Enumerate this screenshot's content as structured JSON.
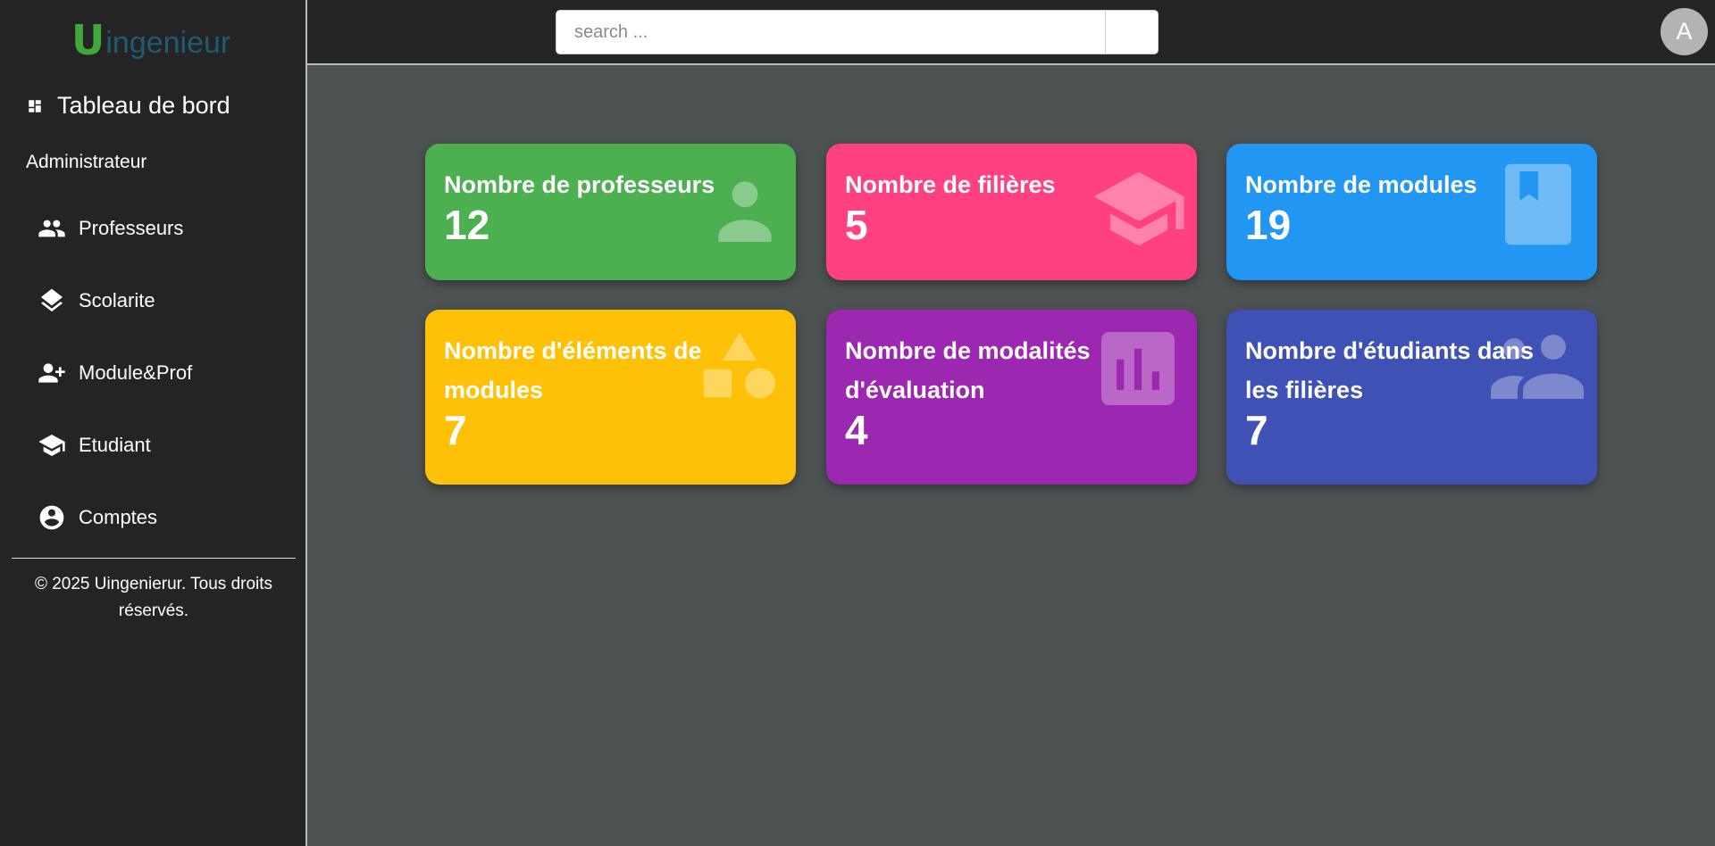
{
  "brand": {
    "logo_letter": "U",
    "logo_rest": "ingenieur"
  },
  "sidebar": {
    "dashboard_label": "Tableau de bord",
    "section_label": "Administrateur",
    "items": [
      {
        "label": "Professeurs",
        "icon": "people-icon"
      },
      {
        "label": "Scolarite",
        "icon": "layers-icon"
      },
      {
        "label": "Module&Prof",
        "icon": "person-add-icon"
      },
      {
        "label": "Etudiant",
        "icon": "school-icon"
      },
      {
        "label": "Comptes",
        "icon": "account-circle-icon"
      }
    ],
    "footer": "© 2025 Uingenierur. Tous droits réservés."
  },
  "topbar": {
    "search_placeholder": "search ...",
    "search_value": "",
    "avatar_letter": "A"
  },
  "cards": [
    {
      "title": "Nombre de professeurs",
      "value": "12",
      "color": "#4caf50",
      "icon": "person-icon"
    },
    {
      "title": "Nombre de filières",
      "value": "5",
      "color": "#ff4081",
      "icon": "graduation-cap-icon"
    },
    {
      "title": "Nombre de modules",
      "value": "19",
      "color": "#2196f3",
      "icon": "book-icon"
    },
    {
      "title": "Nombre d'éléments de modules",
      "value": "7",
      "color": "#ffc107",
      "icon": "shapes-icon"
    },
    {
      "title": "Nombre de modalités d'évaluation",
      "value": "4",
      "color": "#9c27b0",
      "icon": "bar-chart-icon"
    },
    {
      "title": "Nombre d'étudiants dans les filières",
      "value": "7",
      "color": "#3f51b5",
      "icon": "group-icon"
    }
  ]
}
